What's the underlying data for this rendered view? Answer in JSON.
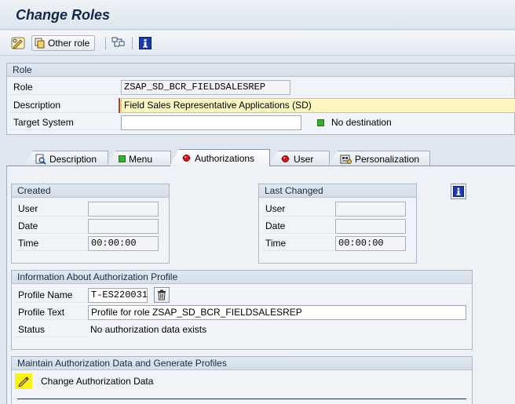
{
  "title": "Change Roles",
  "toolbar": {
    "other_role_label": "Other role"
  },
  "role_group": {
    "header": "Role",
    "role_label": "Role",
    "role_value": "ZSAP_SD_BCR_FIELDSALESREP",
    "description_label": "Description",
    "description_value": "Field Sales Representative Applications (SD)",
    "target_label": "Target System",
    "target_value": "",
    "destination_status": "No destination"
  },
  "tabs": [
    {
      "label": "Description",
      "icon": "document-magnifier-icon"
    },
    {
      "label": "Menu",
      "icon": "green-status-icon"
    },
    {
      "label": "Authorizations",
      "icon": "red-status-icon"
    },
    {
      "label": "User",
      "icon": "red-status-icon"
    },
    {
      "label": "Personalization",
      "icon": "personalization-icon"
    }
  ],
  "created": {
    "header": "Created",
    "user_label": "User",
    "user_value": "",
    "date_label": "Date",
    "date_value": "",
    "time_label": "Time",
    "time_value": "00:00:00"
  },
  "last_changed": {
    "header": "Last Changed",
    "user_label": "User",
    "user_value": "",
    "date_label": "Date",
    "date_value": "",
    "time_label": "Time",
    "time_value": "00:00:00"
  },
  "profile": {
    "header": "Information About Authorization Profile",
    "name_label": "Profile Name",
    "name_value": "T-ES220031",
    "text_label": "Profile Text",
    "text_value": "Profile for role ZSAP_SD_BCR_FIELDSALESREP",
    "status_label": "Status",
    "status_value": "No authorization data exists"
  },
  "maintain": {
    "header": "Maintain Authorization Data and Generate Profiles",
    "change_label": "Change Authorization Data"
  },
  "colors": {
    "title": "#12284a",
    "highlight": "#f7f21a",
    "led_green": "#31b331",
    "led_red": "#d41717"
  }
}
